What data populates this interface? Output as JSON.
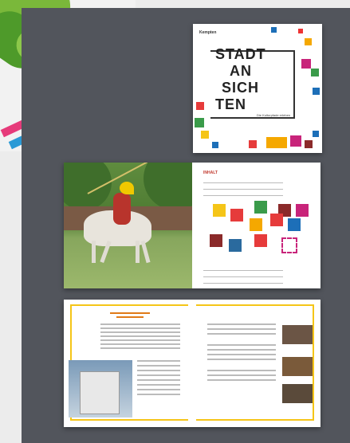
{
  "cover": {
    "brand": "Kempten",
    "title_lines": [
      "STADT",
      "AN",
      "SICH",
      "TEN"
    ],
    "tagline": "Die Kulturpfade erleben"
  },
  "spread2": {
    "heading": "INHALT"
  },
  "colors": {
    "board": "#52555c",
    "accent_yellow": "#f5c518",
    "accent_red": "#c23b30"
  }
}
